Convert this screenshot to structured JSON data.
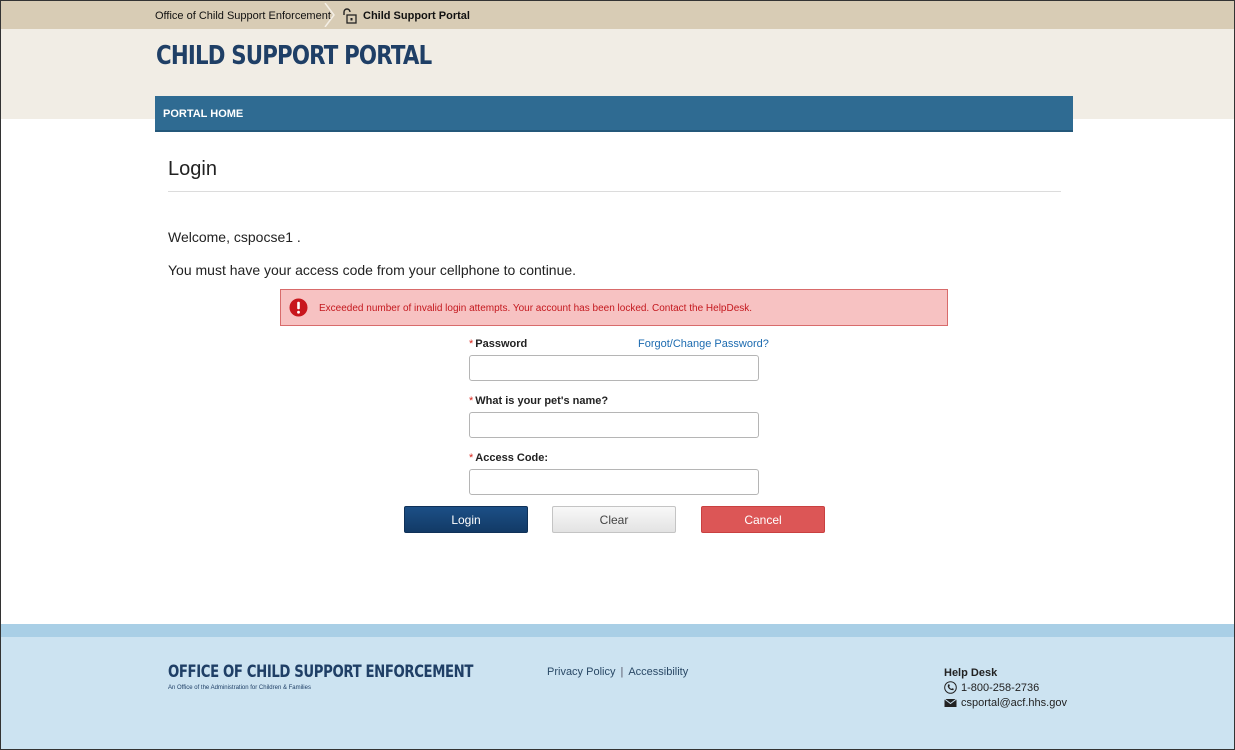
{
  "breadcrumb": {
    "item1": "Office of Child Support Enforcement",
    "item2": "Child Support Portal"
  },
  "header": {
    "title": "CHILD SUPPORT PORTAL"
  },
  "nav": {
    "home": "PORTAL HOME"
  },
  "page": {
    "title": "Login",
    "welcome": "Welcome, cspocse1 .",
    "instruction": "You must have your access code from your cellphone to continue."
  },
  "alert": {
    "message": "Exceeded number of invalid login attempts. Your account has been locked. Contact the HelpDesk."
  },
  "form": {
    "required_marker": "*",
    "password_label": "Password",
    "forgot_link": "Forgot/Change Password?",
    "password_value": "",
    "security_label": "What is your pet's name?",
    "security_value": "",
    "access_label": "Access Code:",
    "access_value": ""
  },
  "buttons": {
    "login": "Login",
    "clear": "Clear",
    "cancel": "Cancel"
  },
  "footer": {
    "logo": "OFFICE OF CHILD SUPPORT ENFORCEMENT",
    "sublogo": "An Office of the Administration for Children & Families",
    "privacy": "Privacy Policy",
    "separator": "|",
    "accessibility": "Accessibility",
    "help_title": "Help Desk",
    "phone": "1-800-258-2736",
    "email": "csportal@acf.hhs.gov"
  },
  "colors": {
    "brand_blue": "#1f3f66",
    "nav_blue": "#2f6b92",
    "alert_bg": "#f7c2c2",
    "alert_text": "#c4181e",
    "cancel_red": "#dc5656"
  }
}
